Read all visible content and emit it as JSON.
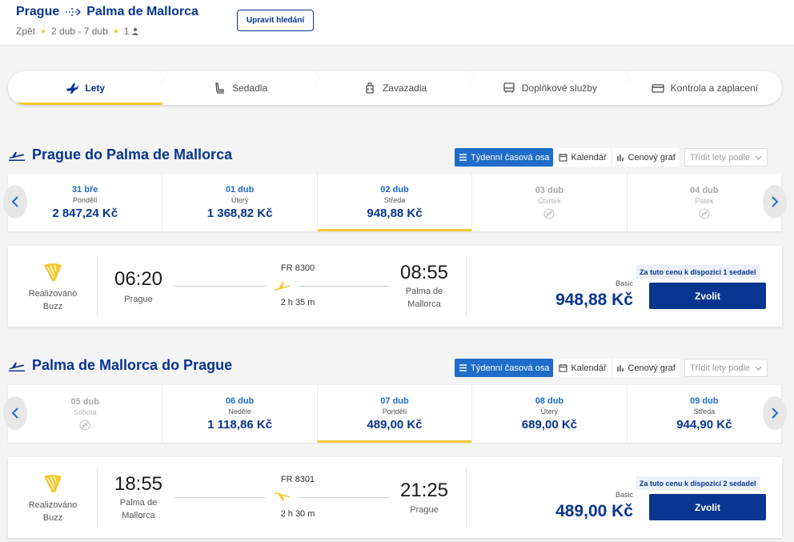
{
  "header": {
    "origin": "Prague",
    "destination": "Palma de Mallorca",
    "trip_type": "Zpět",
    "dates": "2 dub - 7 dub",
    "passengers": "1",
    "edit_label": "Upravit hledání"
  },
  "steps": [
    {
      "label": "Lety",
      "icon": "plane-icon"
    },
    {
      "label": "Sedadla",
      "icon": "seat-icon"
    },
    {
      "label": "Zavazadla",
      "icon": "bag-icon"
    },
    {
      "label": "Doplňkové služby",
      "icon": "bus-icon"
    },
    {
      "label": "Kontrola a zaplacení",
      "icon": "card-icon"
    }
  ],
  "view_tabs": {
    "timeline": "Týdenní časová osa",
    "calendar": "Kalendář",
    "chart": "Cenový graf",
    "sort": "Třídit lety podle"
  },
  "outbound": {
    "title": "Prague do Palma de Mallorca",
    "dates": [
      {
        "day": "31 bře",
        "weekday": "Pondělí",
        "price": "2 847,24 Kč"
      },
      {
        "day": "01 dub",
        "weekday": "Úterý",
        "price": "1 368,82 Kč"
      },
      {
        "day": "02 dub",
        "weekday": "Středa",
        "price": "948,88 Kč"
      },
      {
        "day": "03 dub",
        "weekday": "Čtvrtek",
        "price": ""
      },
      {
        "day": "04 dub",
        "weekday": "Pátek",
        "price": ""
      }
    ],
    "flight": {
      "operator_line1": "Realizováno",
      "operator_line2": "Buzz",
      "dep_time": "06:20",
      "dep_place1": "Prague",
      "dep_place2": "",
      "flight_no": "FR 8300",
      "duration": "2 h 35 m",
      "arr_time": "08:55",
      "arr_place1": "Palma de",
      "arr_place2": "Mallorca",
      "availability": "Za tuto cenu k dispozici 1 sedadel",
      "fare": "Basic",
      "price": "948,88 Kč",
      "select": "Zvolit"
    }
  },
  "inbound": {
    "title": "Palma de Mallorca do Prague",
    "dates": [
      {
        "day": "05 dub",
        "weekday": "Sobota",
        "price": ""
      },
      {
        "day": "06 dub",
        "weekday": "Neděle",
        "price": "1 118,86 Kč"
      },
      {
        "day": "07 dub",
        "weekday": "Pondělí",
        "price": "489,00 Kč"
      },
      {
        "day": "08 dub",
        "weekday": "Úterý",
        "price": "689,00 Kč"
      },
      {
        "day": "09 dub",
        "weekday": "Středa",
        "price": "944,90 Kč"
      }
    ],
    "flight": {
      "operator_line1": "Realizováno",
      "operator_line2": "Buzz",
      "dep_time": "18:55",
      "dep_place1": "Palma de",
      "dep_place2": "Mallorca",
      "flight_no": "FR 8301",
      "duration": "2 h 30 m",
      "arr_time": "21:25",
      "arr_place1": "Prague",
      "arr_place2": "",
      "availability": "Za tuto cenu k dispozici 2 sedadel",
      "fare": "Basic",
      "price": "489,00 Kč",
      "select": "Zvolit"
    }
  },
  "colors": {
    "brand_blue": "#073590",
    "accent_yellow": "#f1c933",
    "link_blue": "#1f6cc9"
  }
}
